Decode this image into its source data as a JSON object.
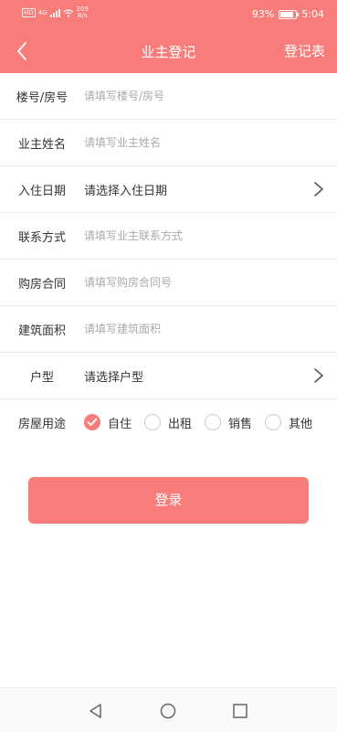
{
  "status_bar": {
    "sim_label": "HD",
    "net_label": "4G",
    "speed_value": "209",
    "speed_unit": "B/s",
    "battery": "93%",
    "time": "5:04"
  },
  "header": {
    "title": "业主登记",
    "action_label": "登记表",
    "back_icon": "chevron-left-icon"
  },
  "form": {
    "fields": [
      {
        "label": "楼号/房号",
        "placeholder": "请填写楼号/房号",
        "value": ""
      },
      {
        "label": "业主姓名",
        "placeholder": "请填写业主姓名",
        "value": ""
      },
      {
        "label": "入住日期",
        "select_text": "请选择入住日期"
      },
      {
        "label": "联系方式",
        "placeholder": "请填写业主联系方式",
        "value": ""
      },
      {
        "label": "购房合同",
        "placeholder": "请填写购房合同号",
        "value": ""
      },
      {
        "label": "建筑面积",
        "placeholder": "请填写建筑面积",
        "value": ""
      },
      {
        "label": "户型",
        "select_text": "请选择户型"
      }
    ],
    "usage": {
      "label": "房屋用途",
      "options": [
        {
          "label": "自住",
          "checked": true
        },
        {
          "label": "出租",
          "checked": false
        },
        {
          "label": "销售",
          "checked": false
        },
        {
          "label": "其他",
          "checked": false
        }
      ]
    }
  },
  "login_button": "登录",
  "colors": {
    "accent": "#f77c7a",
    "divider": "#ececec",
    "placeholder": "#aaaaaa"
  }
}
